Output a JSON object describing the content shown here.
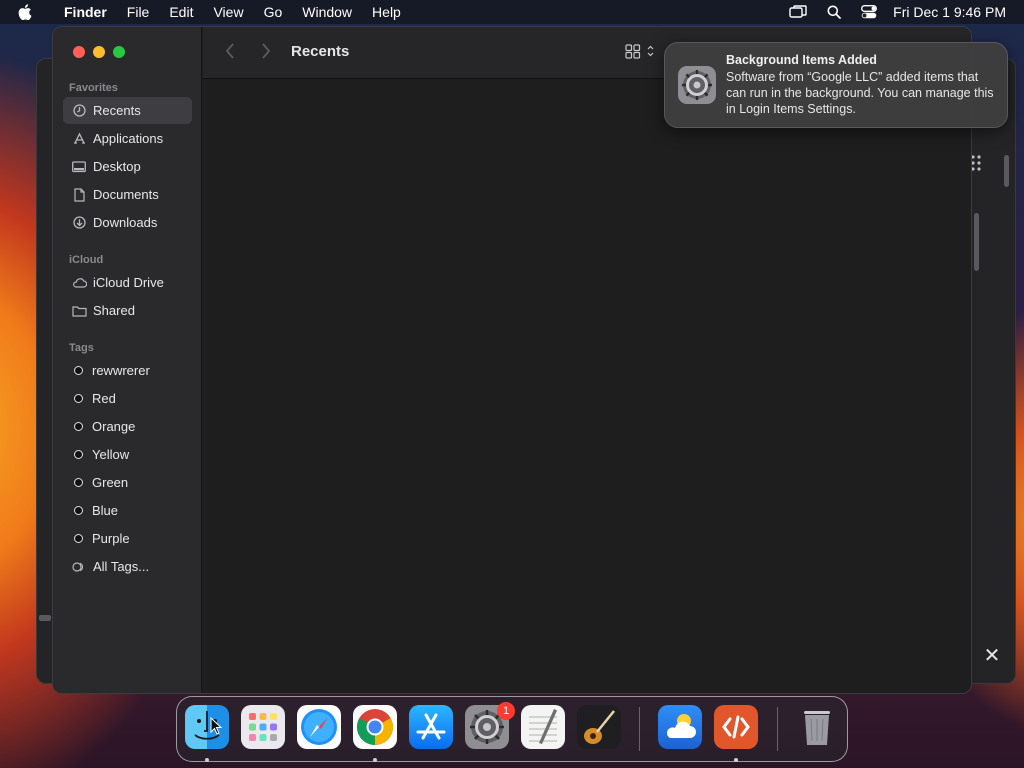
{
  "menubar": {
    "app_name": "Finder",
    "items": [
      "File",
      "Edit",
      "View",
      "Go",
      "Window",
      "Help"
    ],
    "clock": "Fri Dec 1  9:46 PM"
  },
  "finder": {
    "title": "Recents",
    "sidebar": {
      "favorites_header": "Favorites",
      "favorites": [
        {
          "label": "Recents",
          "icon": "clock-icon"
        },
        {
          "label": "Applications",
          "icon": "applications-icon"
        },
        {
          "label": "Desktop",
          "icon": "desktop-icon"
        },
        {
          "label": "Documents",
          "icon": "document-icon"
        },
        {
          "label": "Downloads",
          "icon": "download-icon"
        }
      ],
      "icloud_header": "iCloud",
      "icloud": [
        {
          "label": "iCloud Drive",
          "icon": "cloud-icon"
        },
        {
          "label": "Shared",
          "icon": "shared-folder-icon"
        }
      ],
      "tags_header": "Tags",
      "tags": [
        {
          "label": "rewwrerer"
        },
        {
          "label": "Red"
        },
        {
          "label": "Orange"
        },
        {
          "label": "Yellow"
        },
        {
          "label": "Green"
        },
        {
          "label": "Blue"
        },
        {
          "label": "Purple"
        },
        {
          "label": "All Tags..."
        }
      ]
    }
  },
  "notification": {
    "title": "Background Items Added",
    "body": "Software from “Google LLC” added items that can run in the background. You can manage this in Login Items Settings."
  },
  "dock": {
    "apps": [
      {
        "name": "Finder",
        "icon": "finder-icon",
        "running": true
      },
      {
        "name": "Launchpad",
        "icon": "launchpad-icon",
        "running": false
      },
      {
        "name": "Safari",
        "icon": "safari-icon",
        "running": false
      },
      {
        "name": "Google Chrome",
        "icon": "chrome-icon",
        "running": true
      },
      {
        "name": "App Store",
        "icon": "app-store-icon",
        "running": false
      },
      {
        "name": "System Settings",
        "icon": "settings-gear-icon",
        "running": false,
        "badge": "1"
      },
      {
        "name": "TextEdit",
        "icon": "textedit-icon",
        "running": false
      },
      {
        "name": "GarageBand",
        "icon": "guitar-icon",
        "running": false
      },
      {
        "name": "Weather",
        "icon": "weather-icon",
        "running": false
      },
      {
        "name": "Remote Desktop",
        "icon": "remote-desktop-icon",
        "running": true
      },
      {
        "name": "Trash",
        "icon": "trash-icon",
        "running": false
      }
    ]
  }
}
